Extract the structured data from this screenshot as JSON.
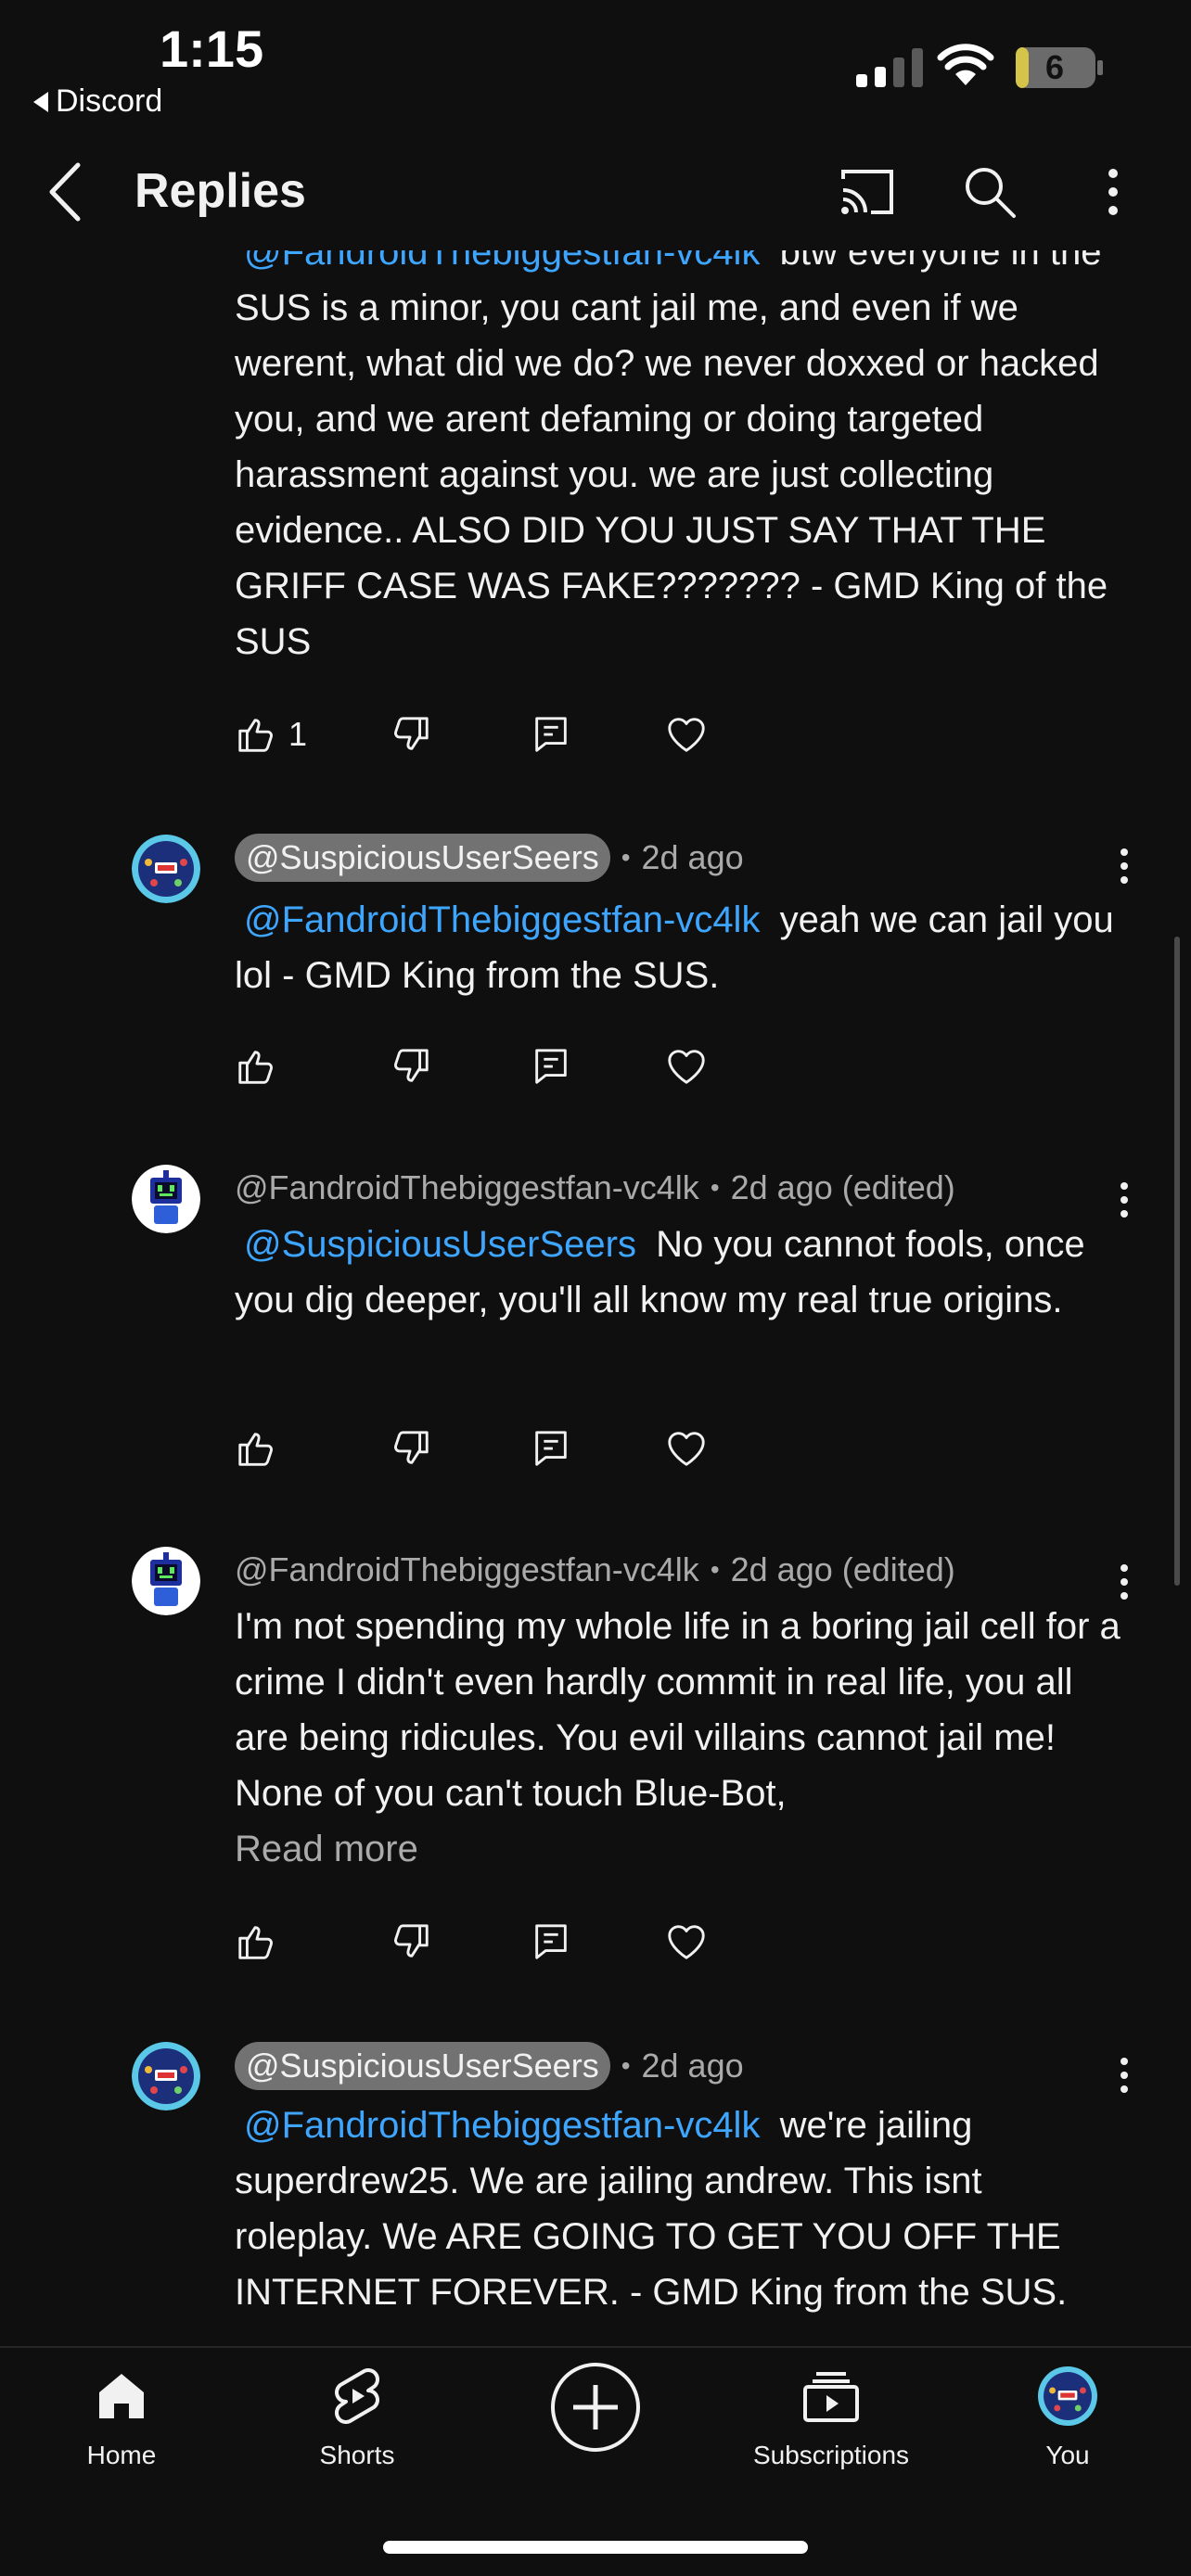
{
  "status_bar": {
    "time": "1:15",
    "back_app": "Discord",
    "battery_level": "6"
  },
  "header": {
    "title": "Replies"
  },
  "partial_comment": {
    "mention": "@FandroidThebiggestfan-vc4lk",
    "text": "btw everyone in the SUS is a minor, you cant jail me, and even if we werent, what did we do? we never doxxed or hacked you, and we arent defaming or doing targeted harassment against you. we are just collecting evidence.. ALSO DID YOU JUST SAY THAT THE GRIFF CASE WAS FAKE??????? - GMD King of the SUS",
    "like_count": "1"
  },
  "comments": [
    {
      "author": "@SuspiciousUserSeers",
      "time": "2d ago",
      "mention": "@FandroidThebiggestfan-vc4lk",
      "text": "yeah we can jail you lol - GMD King from the SUS."
    },
    {
      "author": "@FandroidThebiggestfan-vc4lk",
      "time": "2d ago (edited)",
      "mention": "@SuspiciousUserSeers",
      "text": "No you cannot fools, once you dig deeper, you'll all know my real true origins."
    },
    {
      "author": "@FandroidThebiggestfan-vc4lk",
      "time": "2d ago (edited)",
      "text": "I'm not spending my whole life in a boring jail cell for a crime I didn't even hardly commit in real life, you all are being ridicules. You evil villains cannot jail me! None of you can't touch Blue-Bot,",
      "read_more": "Read more"
    },
    {
      "author": "@SuspiciousUserSeers",
      "time": "2d ago",
      "mention": "@FandroidThebiggestfan-vc4lk",
      "text": "we're jailing superdrew25. We are jailing andrew. This isnt roleplay. We ARE GOING TO GET YOU OFF THE INTERNET FOREVER. - GMD King from the SUS."
    }
  ],
  "nav": {
    "home": "Home",
    "shorts": "Shorts",
    "subscriptions": "Subscriptions",
    "you": "You"
  },
  "colors": {
    "background": "#0f0f0f",
    "mention": "#3ea6ff",
    "author_chip": "#727272",
    "meta": "#aaaaaa",
    "battery": "#d4c44a"
  },
  "icons": [
    "chevron-left-icon",
    "cast-icon",
    "search-icon",
    "more-vert-icon",
    "thumb-up-icon",
    "thumb-down-icon",
    "reply-icon",
    "heart-icon",
    "home-icon",
    "shorts-icon",
    "create-plus-icon",
    "subscriptions-icon"
  ]
}
